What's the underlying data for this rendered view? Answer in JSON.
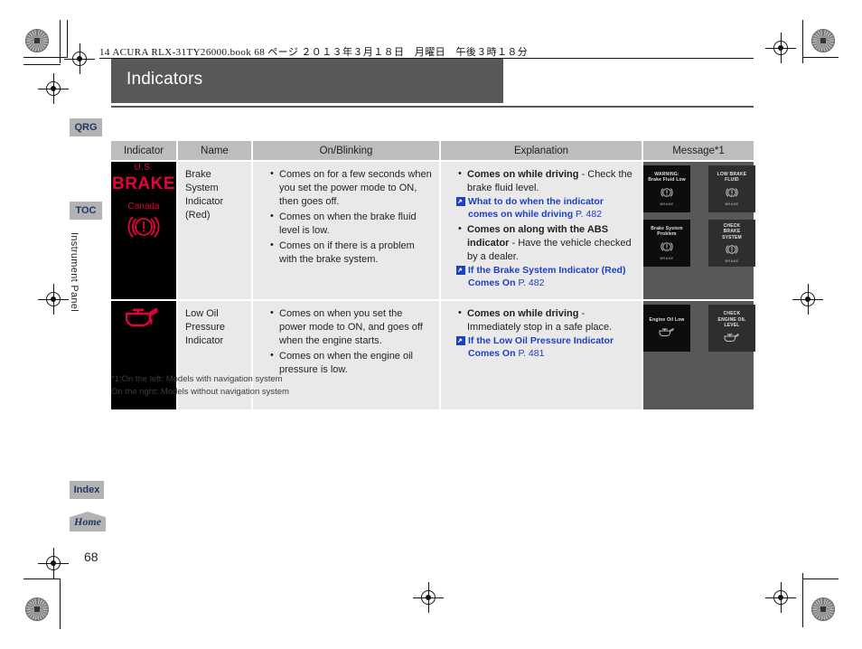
{
  "running_header": "14 ACURA RLX-31TY26000.book  68 ページ  ２０１３年３月１８日　月曜日　午後３時１８分",
  "page_title": "Indicators",
  "page_number": "68",
  "section_label": "Instrument Panel",
  "nav_tabs": {
    "qrg": "QRG",
    "toc": "TOC",
    "index": "Index",
    "home": "Home"
  },
  "table": {
    "headers": {
      "indicator": "Indicator",
      "name": "Name",
      "on_blinking": "On/Blinking",
      "explanation": "Explanation",
      "message": "Message*1"
    },
    "rows": [
      {
        "indicator_graphic": {
          "us_label": "U.S.",
          "brake_word": "BRAKE",
          "canada_label": "Canada",
          "symbol": "brake-system-icon"
        },
        "name": "Brake System Indicator (Red)",
        "on_blinking": [
          "Comes on for a few seconds when you set the power mode to ON, then goes off.",
          "Comes on when the brake fluid level is low.",
          "Comes on if there is a problem with the brake system."
        ],
        "explanation": [
          {
            "lead": "Comes on while driving",
            "rest": " - Check the brake fluid level.",
            "ref": "What to do when the indicator comes on while driving",
            "ref_page": "P. 482"
          },
          {
            "lead": "Comes on along with the ABS indicator",
            "rest": " - Have the vehicle checked by a dealer.",
            "ref": "If the Brake System Indicator (Red) Comes On",
            "ref_page": "P. 482"
          }
        ],
        "messages_left": [
          {
            "title": "WARNING:\nBrake Fluid Low",
            "icon": "brake-system-icon",
            "caption": "BRAKE"
          },
          {
            "title": "Brake System\nProblem",
            "icon": "brake-system-icon",
            "caption": "BRAKE"
          }
        ],
        "messages_right": [
          {
            "title": "LOW BRAKE\nFLUID",
            "icon": "brake-system-icon",
            "caption": "BRAKE"
          },
          {
            "title": "CHECK\nBRAKE\nSYSTEM",
            "icon": "brake-system-icon",
            "caption": "BRAKE"
          }
        ]
      },
      {
        "indicator_graphic": {
          "symbol": "oil-can-icon"
        },
        "name": "Low Oil Pressure Indicator",
        "on_blinking": [
          "Comes on when you set the power mode to ON, and goes off when the engine starts.",
          "Comes on when the engine oil pressure is low."
        ],
        "explanation": [
          {
            "lead": "Comes on while driving",
            "rest": " - Immediately stop in a safe place.",
            "ref": "If the Low Oil Pressure Indicator Comes On",
            "ref_page": "P. 481"
          }
        ],
        "messages_left": [
          {
            "title": "Engine Oil Low",
            "icon": "oil-can-icon",
            "caption": ""
          }
        ],
        "messages_right": [
          {
            "title": "CHECK\nENGINE OIL\nLEVEL",
            "icon": "oil-can-icon",
            "caption": ""
          }
        ]
      }
    ]
  },
  "footnote": "*1:On the left: Models with navigation system\n     On the right: Models without navigation system",
  "colors": {
    "title_band": "#58585a",
    "indicator_red": "#e8003c",
    "link_blue": "#1d3fc4",
    "header_gray": "#bdbdbd",
    "cell_gray": "#e9e9e9",
    "tab_gray": "#b3b3b3",
    "tab_text": "#1f3864"
  }
}
